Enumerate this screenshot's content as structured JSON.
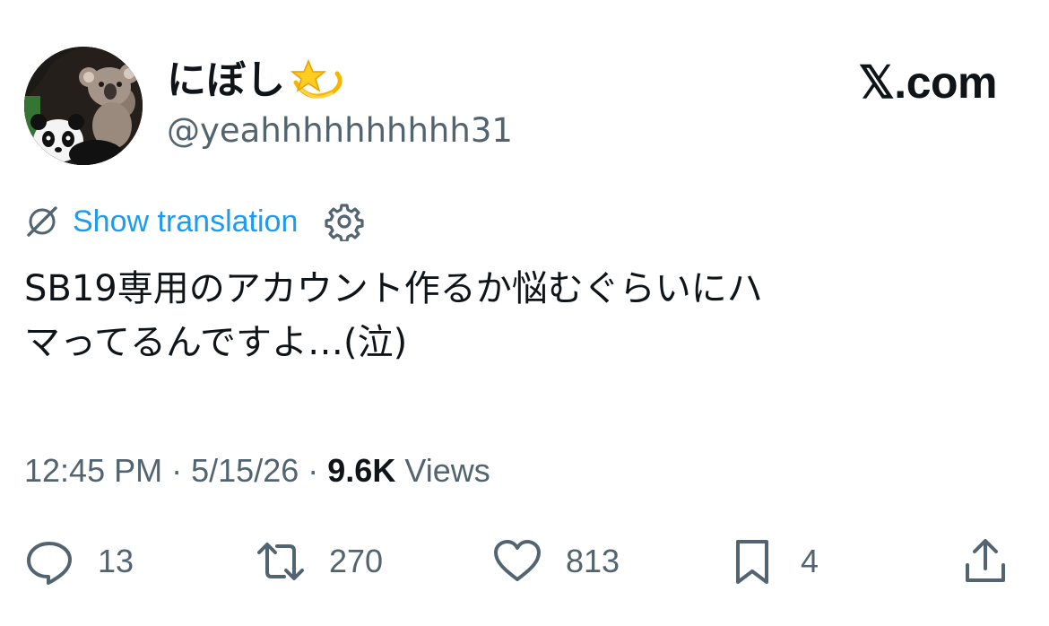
{
  "author": {
    "display_name": "にぼし",
    "name_emoji": "dizzy-star-emoji",
    "handle": "@yeahhhhhhhhhh31",
    "avatar": "panda-and-koala-avatar"
  },
  "brand": {
    "logo_text": "𝕏.com"
  },
  "translation": {
    "icon": "globe-off-icon",
    "label": "Show translation",
    "settings_icon": "gear-icon"
  },
  "tweet": {
    "text": "SB19専用のアカウント作るか悩むぐらいにハ\nマってるんですよ…(泣)"
  },
  "meta": {
    "time": "12:45 PM",
    "separator": "·",
    "date": "5/15/26",
    "views_count": "9.6K",
    "views_label": "Views"
  },
  "actions": {
    "replies": "13",
    "reposts": "270",
    "likes": "813",
    "bookmarks": "4"
  },
  "colors": {
    "link": "#1d9bf0",
    "secondary_text": "#536471",
    "primary_text": "#0f1419"
  }
}
